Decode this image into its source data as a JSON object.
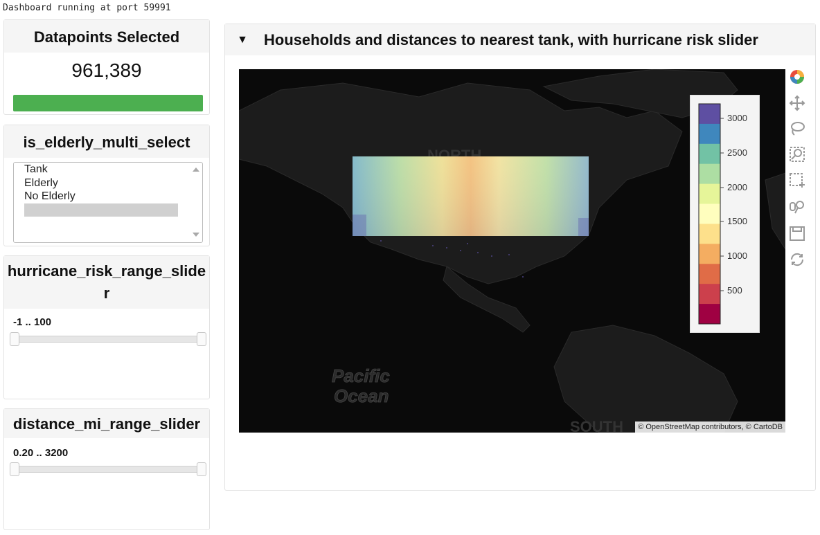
{
  "status_line": "Dashboard running at port 59991",
  "datapoints": {
    "title": "Datapoints Selected",
    "value": "961,389",
    "progress": 1.0,
    "progress_color": "#4caf50"
  },
  "elderly_select": {
    "title": "is_elderly_multi_select",
    "options": [
      "Tank",
      "Elderly",
      "No Elderly",
      ""
    ]
  },
  "hurricane_slider": {
    "title": "hurricane_risk_range_slider",
    "value_text": "-1 .. 100",
    "min": -1,
    "max": 100,
    "low": -1,
    "high": 100
  },
  "distance_slider": {
    "title": "distance_mi_range_slider",
    "value_text": "0.20 .. 3200",
    "min": 0.2,
    "max": 3200,
    "low": 0.2,
    "high": 3200
  },
  "main": {
    "collapse_arrow": "▼",
    "title": "Households and distances to nearest tank, with hurricane risk slider"
  },
  "map": {
    "basemap_labels": {
      "north": "NORTH",
      "south": "SOUTH",
      "ocean": "Pacific",
      "ocean2": "Ocean"
    },
    "attribution": "© OpenStreetMap contributors, © CartoDB"
  },
  "colorbar": {
    "ticks": [
      "3000",
      "2500",
      "2000",
      "1500",
      "1000",
      "500"
    ],
    "colors": [
      "#5e4fa2",
      "#3f87bd",
      "#72c2a5",
      "#addea3",
      "#e6f599",
      "#fffebe",
      "#fde08b",
      "#f4ad61",
      "#e06c47",
      "#cc404c",
      "#9f0142"
    ]
  },
  "toolbar": [
    "bokeh-logo-icon",
    "pan-icon",
    "lasso-select-icon",
    "box-zoom-icon",
    "box-select-icon",
    "wheel-zoom-icon",
    "save-icon",
    "reset-icon"
  ]
}
